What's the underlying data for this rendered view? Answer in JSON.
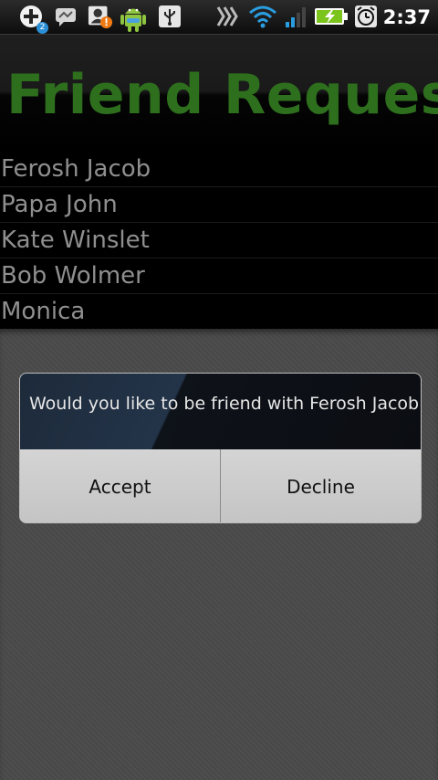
{
  "status_bar": {
    "notification_count": "2",
    "time": "2:37",
    "icons": [
      "add-icon",
      "chat-icon",
      "contact-alert-icon",
      "android-icon",
      "usb-icon",
      "network-icon",
      "wifi-icon",
      "signal-icon",
      "battery-charging-icon",
      "alarm-icon"
    ]
  },
  "header": {
    "title": "Friend Requests",
    "title_color": "#2e6f1e"
  },
  "list": {
    "items": [
      {
        "label": "Ferosh Jacob"
      },
      {
        "label": "Papa John"
      },
      {
        "label": "Kate Winslet"
      },
      {
        "label": "Bob Wolmer"
      },
      {
        "label": "Monica"
      }
    ]
  },
  "dialog": {
    "message": "Would you like to be friend with Ferosh Jacob",
    "accept_label": "Accept",
    "decline_label": "Decline"
  }
}
